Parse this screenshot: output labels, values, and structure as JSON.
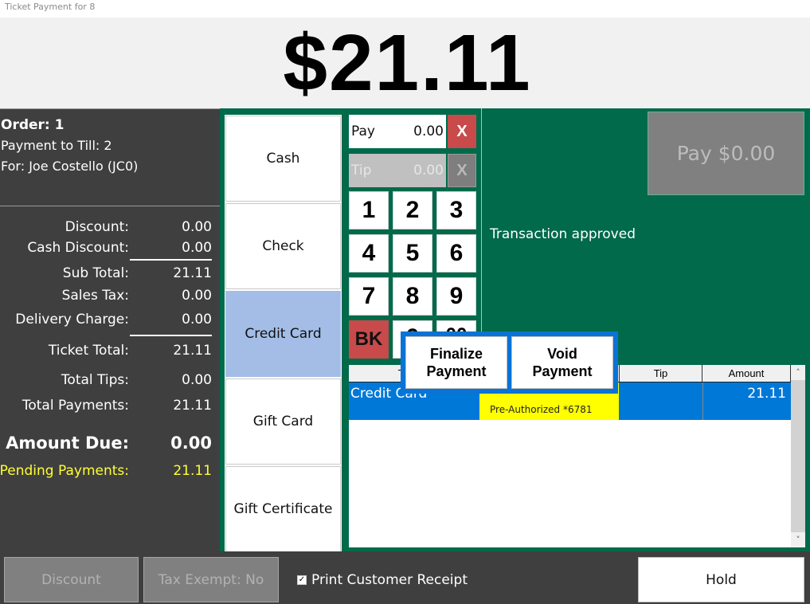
{
  "window": {
    "title": "Ticket Payment for 8"
  },
  "header": {
    "total_display": "$21.11"
  },
  "order_info": {
    "order": "Order: 1",
    "till": "Payment to Till: 2",
    "customer": "For: Joe Costello (JC0)"
  },
  "summary": {
    "discount": {
      "label": "Discount:",
      "value": "0.00"
    },
    "cash_discount": {
      "label": "Cash Discount:",
      "value": "0.00"
    },
    "sub_total": {
      "label": "Sub Total:",
      "value": "21.11"
    },
    "sales_tax": {
      "label": "Sales Tax:",
      "value": "0.00"
    },
    "delivery_charge": {
      "label": "Delivery Charge:",
      "value": "0.00"
    },
    "ticket_total": {
      "label": "Ticket Total:",
      "value": "21.11"
    },
    "total_tips": {
      "label": "Total Tips:",
      "value": "0.00"
    },
    "total_payments": {
      "label": "Total Payments:",
      "value": "21.11"
    },
    "amount_due": {
      "label": "Amount Due:",
      "value": "0.00"
    },
    "pending_payments": {
      "label": "Pending Payments:",
      "value": "21.11"
    }
  },
  "tenders": [
    {
      "label": "Cash",
      "active": false
    },
    {
      "label": "Check",
      "active": false
    },
    {
      "label": "Credit Card",
      "active": true
    },
    {
      "label": "Gift Card",
      "active": false
    },
    {
      "label": "Gift Certificate",
      "active": false
    }
  ],
  "entry": {
    "pay": {
      "label": "Pay",
      "value": "0.00",
      "clear": "X"
    },
    "tip": {
      "label": "Tip",
      "value": "0.00",
      "clear": "X",
      "disabled": true
    }
  },
  "keypad": {
    "keys": [
      "1",
      "2",
      "3",
      "4",
      "5",
      "6",
      "7",
      "8",
      "9",
      "BK",
      "0",
      "00"
    ]
  },
  "pay_button": {
    "label": "Pay $0.00"
  },
  "status_message": "Transaction approved",
  "payments_grid": {
    "columns": [
      "Tender",
      "Tip",
      "Amount"
    ],
    "rows": [
      {
        "tender": "Credit Card",
        "note": "Pre-Authorized *6781",
        "tip": "",
        "amount": "21.11"
      }
    ],
    "scroll_up": "˄",
    "scroll_down": "˅"
  },
  "popup": {
    "finalize_label": "Finalize\nPayment",
    "void_label": "Void\nPayment"
  },
  "bottom_bar": {
    "discount_label": "Discount",
    "tax_exempt_label": "Tax Exempt: No",
    "print_receipt_label": "Print Customer Receipt",
    "print_receipt_checked": true,
    "hold_label": "Hold"
  },
  "colors": {
    "panel_green": "#006a4a",
    "panel_dark": "#3f3f3f",
    "selected_row": "#0078d7",
    "active_tender": "#a3bde6",
    "clear_red": "#c84a4a",
    "pending_yellow": "#ffff33",
    "note_yellow": "#ffff00"
  }
}
